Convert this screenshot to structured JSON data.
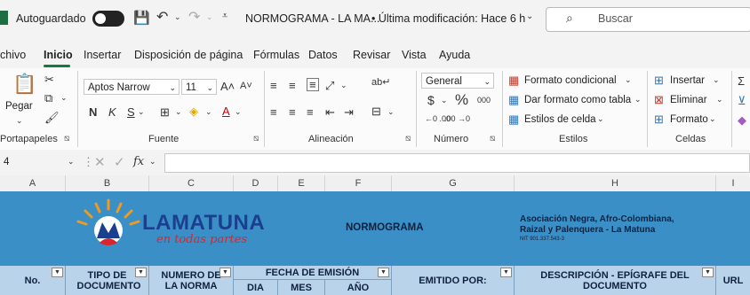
{
  "titlebar": {
    "autosave_label": "Autoguardado",
    "doc_title": "NORMOGRAMA - LA MA...",
    "modified": "• Última modificación: Hace 6 h",
    "search_placeholder": "Buscar"
  },
  "menu": {
    "tabs": [
      "chivo",
      "Inicio",
      "Insertar",
      "Disposición de página",
      "Fórmulas",
      "Datos",
      "Revisar",
      "Vista",
      "Ayuda"
    ]
  },
  "ribbon": {
    "clipboard": {
      "paste_label": "Pegar",
      "group_label": "Portapapeles"
    },
    "font": {
      "name": "Aptos Narrow",
      "size": "11",
      "bold": "N",
      "italic": "K",
      "underline": "S",
      "group_label": "Fuente"
    },
    "alignment": {
      "group_label": "Alineación"
    },
    "number": {
      "format": "General",
      "currency": "$",
      "percent": "%",
      "thousands": "000",
      "inc_decimal": "←0 .00",
      "dec_decimal": ".00 →0",
      "group_label": "Número"
    },
    "styles": {
      "conditional": "Formato condicional",
      "table": "Dar formato como tabla",
      "cell": "Estilos de celda",
      "group_label": "Estilos"
    },
    "cells": {
      "insert": "Insertar",
      "delete": "Eliminar",
      "format": "Formato",
      "group_label": "Celdas"
    }
  },
  "formula_bar": {
    "name_box": "4",
    "fx": "fx"
  },
  "columns": [
    "A",
    "B",
    "C",
    "D",
    "E",
    "F",
    "G",
    "H",
    "I"
  ],
  "sheet": {
    "logo_title": "LAMATUNA",
    "logo_tagline": "en todas partes",
    "banner_title": "NORMOGRAMA",
    "org_line1": "Asociación Negra, Afro-Colombiana,",
    "org_line2": "Raizal y Palenquera - La Matuna",
    "org_nit": "NIT 901.337.543-3",
    "headers": {
      "no": "No.",
      "tipo": "TIPO DE DOCUMENTO",
      "numero": "NUMERO DE LA NORMA",
      "fecha": "FECHA DE EMISIÓN",
      "dia": "DIA",
      "mes": "MES",
      "anio": "AÑO",
      "emitido": "EMITIDO POR:",
      "descripcion": "DESCRIPCIÓN - EPÍGRAFE DEL DOCUMENTO",
      "url": "URL"
    }
  },
  "colors": {
    "banner": "#3a8fc6",
    "header_fill": "#b9d3ea",
    "excel_green": "#107c41",
    "logo_orange": "#f29a1c",
    "logo_red": "#d9262c",
    "logo_blue": "#1b3f8f"
  }
}
